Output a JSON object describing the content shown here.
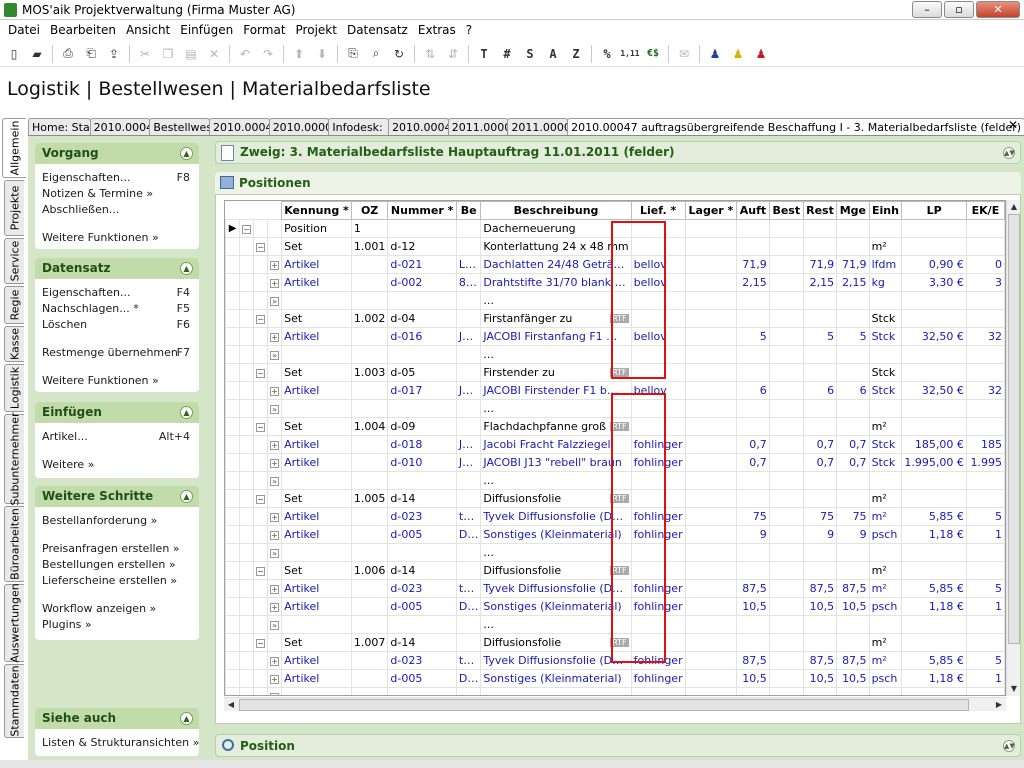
{
  "window": {
    "title": "MOS'aik Projektverwaltung (Firma Muster AG)",
    "min": "–",
    "max": "▫",
    "close": "✕"
  },
  "menu": [
    "Datei",
    "Bearbeiten",
    "Ansicht",
    "Einfügen",
    "Format",
    "Projekt",
    "Datensatz",
    "Extras",
    "?"
  ],
  "toolbar": {
    "format_t": "T",
    "format_hash": "#",
    "format_s": "S",
    "format_a": "A",
    "format_z": "Z",
    "percent": "%",
    "decimal": "1,11",
    "euro": "€$"
  },
  "heading": "Logistik | Bestellwesen | Materialbedarfsliste",
  "tabs": [
    "Home: Sta",
    "2010.0004",
    "Bestellwes",
    "2010.0004",
    "2010.0000",
    "Infodesk:",
    "2010.0004",
    "2011.0000",
    "2011.0000",
    "2010.00047 auftragsübergreifende Beschaffung I - 3. Materialbedarfsliste (felder)"
  ],
  "vtabs": [
    "Allgemein",
    "Projekte",
    "Service",
    "Regie",
    "Kasse",
    "Logistik",
    "Subunternehmer",
    "Büroarbeiten",
    "Auswertungen",
    "Stammdaten"
  ],
  "sidebar": {
    "vorgang": {
      "title": "Vorgang",
      "items": [
        {
          "label": "Eigenschaften...",
          "shortcut": "F8"
        },
        {
          "label": "Notizen & Termine »",
          "shortcut": ""
        },
        {
          "label": "Abschließen...",
          "shortcut": ""
        }
      ],
      "more": "Weitere Funktionen »"
    },
    "datensatz": {
      "title": "Datensatz",
      "items": [
        {
          "label": "Eigenschaften...",
          "shortcut": "F4"
        },
        {
          "label": "Nachschlagen... *",
          "shortcut": "F5"
        },
        {
          "label": "Löschen",
          "shortcut": "F6"
        }
      ],
      "extra": {
        "label": "Restmenge übernehmen",
        "shortcut": "F7"
      },
      "more": "Weitere Funktionen »"
    },
    "einfuegen": {
      "title": "Einfügen",
      "items": [
        {
          "label": "Artikel...",
          "shortcut": "Alt+4"
        }
      ],
      "more": "Weitere »"
    },
    "schritte": {
      "title": "Weitere Schritte",
      "items": [
        "Bestellanforderung »",
        "Preisanfragen erstellen »",
        "Bestellungen erstellen »",
        "Lieferscheine erstellen »",
        "Workflow anzeigen »",
        "Plugins »"
      ]
    },
    "siehe": {
      "title": "Siehe auch",
      "items": [
        "Listen & Strukturansichten »"
      ]
    }
  },
  "branch": "Zweig: 3. Materialbedarfsliste Hauptauftrag 11.01.2011 (felder)",
  "positions_title": "Positionen",
  "position_title": "Position",
  "grid": {
    "columns": [
      "Kennung *",
      "OZ",
      "Nummer *",
      "Be",
      "Beschreibung",
      "Lief. *",
      "Lager *",
      "Auft",
      "Best",
      "Rest",
      "Mge",
      "Einh",
      "LP",
      "EK/E"
    ],
    "rows": [
      {
        "t": "head",
        "k": "Position",
        "oz": "1",
        "n": "",
        "be": "",
        "b": "Dacherneuerung",
        "l": "",
        "a": "",
        "r": "",
        "m": "",
        "e": "",
        "lp": "",
        "ek": ""
      },
      {
        "t": "set",
        "k": "Set",
        "oz": "1.001",
        "n": "d-12",
        "be": "",
        "b": "Konterlattung 24 x 48 mm",
        "l": "",
        "a": "",
        "r": "",
        "m": "",
        "e": "m²",
        "lp": "",
        "ek": ""
      },
      {
        "t": "art",
        "k": "Artikel",
        "oz": "",
        "n": "d-021",
        "be": "L…",
        "b": "Dachlatten 24/48 Geträ…",
        "l": "bellov",
        "a": "71,9",
        "r": "71,9",
        "m": "71,9",
        "e": "lfdm",
        "lp": "0,90 €",
        "ek": "0"
      },
      {
        "t": "art",
        "k": "Artikel",
        "oz": "",
        "n": "d-002",
        "be": "8…",
        "b": "Drahtstifte 31/70 blank …",
        "l": "bellov",
        "a": "2,15",
        "r": "2,15",
        "m": "2,15",
        "e": "kg",
        "lp": "3,30 €",
        "ek": "3"
      },
      {
        "t": "dots",
        "b": "..."
      },
      {
        "t": "set",
        "k": "Set",
        "oz": "1.002",
        "n": "d-04",
        "be": "",
        "b": "Firstanfänger zu",
        "rtf": true,
        "l": "",
        "a": "",
        "r": "",
        "m": "",
        "e": "Stck",
        "lp": "",
        "ek": ""
      },
      {
        "t": "art",
        "k": "Artikel",
        "oz": "",
        "n": "d-016",
        "be": "J…",
        "b": "JACOBI Firstanfang F1 …",
        "l": "bellov",
        "a": "5",
        "r": "5",
        "m": "5",
        "e": "Stck",
        "lp": "32,50 €",
        "ek": "32"
      },
      {
        "t": "dots",
        "b": "..."
      },
      {
        "t": "set",
        "k": "Set",
        "oz": "1.003",
        "n": "d-05",
        "be": "",
        "b": "Firstender zu",
        "rtf": true,
        "l": "",
        "a": "",
        "r": "",
        "m": "",
        "e": "Stck",
        "lp": "",
        "ek": ""
      },
      {
        "t": "art",
        "k": "Artikel",
        "oz": "",
        "n": "d-017",
        "be": "J…",
        "b": "JACOBI Firstender  F1 b…",
        "l": "bellov",
        "a": "6",
        "r": "6",
        "m": "6",
        "e": "Stck",
        "lp": "32,50 €",
        "ek": "32"
      },
      {
        "t": "dots",
        "b": "..."
      },
      {
        "t": "set",
        "k": "Set",
        "oz": "1.004",
        "n": "d-09",
        "be": "",
        "b": "Flachdachpfanne groß",
        "rtf": true,
        "l": "",
        "a": "",
        "r": "",
        "m": "",
        "e": "m²",
        "lp": "",
        "ek": ""
      },
      {
        "t": "art",
        "k": "Artikel",
        "oz": "",
        "n": "d-018",
        "be": "J…",
        "b": "Jacobi Fracht Falzziegel",
        "l": "fohlinger",
        "a": "0,7",
        "r": "0,7",
        "m": "0,7",
        "e": "Stck",
        "lp": "185,00 €",
        "ek": "185"
      },
      {
        "t": "art",
        "k": "Artikel",
        "oz": "",
        "n": "d-010",
        "be": "J…",
        "b": "JACOBI J13 \"rebell\" braun",
        "l": "fohlinger",
        "a": "0,7",
        "r": "0,7",
        "m": "0,7",
        "e": "Stck",
        "lp": "1.995,00 €",
        "ek": "1.995"
      },
      {
        "t": "dots",
        "b": "..."
      },
      {
        "t": "set",
        "k": "Set",
        "oz": "1.005",
        "n": "d-14",
        "be": "",
        "b": "Diffusionsfolie",
        "rtf": true,
        "l": "",
        "a": "",
        "r": "",
        "m": "",
        "e": "m²",
        "lp": "",
        "ek": ""
      },
      {
        "t": "art",
        "k": "Artikel",
        "oz": "",
        "n": "d-023",
        "be": "t…",
        "b": "Tyvek Diffusionsfolie (D…",
        "l": "fohlinger",
        "a": "75",
        "r": "75",
        "m": "75",
        "e": "m²",
        "lp": "5,85 €",
        "ek": "5"
      },
      {
        "t": "art",
        "k": "Artikel",
        "oz": "",
        "n": "d-005",
        "be": "D…",
        "b": "Sonstiges (Kleinmaterial)",
        "l": "fohlinger",
        "a": "9",
        "r": "9",
        "m": "9",
        "e": "psch",
        "lp": "1,18 €",
        "ek": "1"
      },
      {
        "t": "dots",
        "b": "..."
      },
      {
        "t": "set",
        "k": "Set",
        "oz": "1.006",
        "n": "d-14",
        "be": "",
        "b": "Diffusionsfolie",
        "rtf": true,
        "l": "",
        "a": "",
        "r": "",
        "m": "",
        "e": "m²",
        "lp": "",
        "ek": ""
      },
      {
        "t": "art",
        "k": "Artikel",
        "oz": "",
        "n": "d-023",
        "be": "t…",
        "b": "Tyvek Diffusionsfolie (D…",
        "l": "fohlinger",
        "a": "87,5",
        "r": "87,5",
        "m": "87,5",
        "e": "m²",
        "lp": "5,85 €",
        "ek": "5"
      },
      {
        "t": "art",
        "k": "Artikel",
        "oz": "",
        "n": "d-005",
        "be": "D…",
        "b": "Sonstiges (Kleinmaterial)",
        "l": "fohlinger",
        "a": "10,5",
        "r": "10,5",
        "m": "10,5",
        "e": "psch",
        "lp": "1,18 €",
        "ek": "1"
      },
      {
        "t": "dots",
        "b": "..."
      },
      {
        "t": "set",
        "k": "Set",
        "oz": "1.007",
        "n": "d-14",
        "be": "",
        "b": "Diffusionsfolie",
        "rtf": true,
        "l": "",
        "a": "",
        "r": "",
        "m": "",
        "e": "m²",
        "lp": "",
        "ek": ""
      },
      {
        "t": "art",
        "k": "Artikel",
        "oz": "",
        "n": "d-023",
        "be": "t…",
        "b": "Tyvek Diffusionsfolie (D…",
        "l": "fohlinger",
        "a": "87,5",
        "r": "87,5",
        "m": "87,5",
        "e": "m²",
        "lp": "5,85 €",
        "ek": "5"
      },
      {
        "t": "art",
        "k": "Artikel",
        "oz": "",
        "n": "d-005",
        "be": "D…",
        "b": "Sonstiges (Kleinmaterial)",
        "l": "fohlinger",
        "a": "10,5",
        "r": "10,5",
        "m": "10,5",
        "e": "psch",
        "lp": "1,18 €",
        "ek": "1"
      },
      {
        "t": "dots",
        "b": "..."
      }
    ]
  },
  "colors": {
    "accent_green": "#226015",
    "panel_green": "#d5e6c8",
    "highlight_red": "#e01010",
    "link_blue": "#1a1ab5"
  }
}
